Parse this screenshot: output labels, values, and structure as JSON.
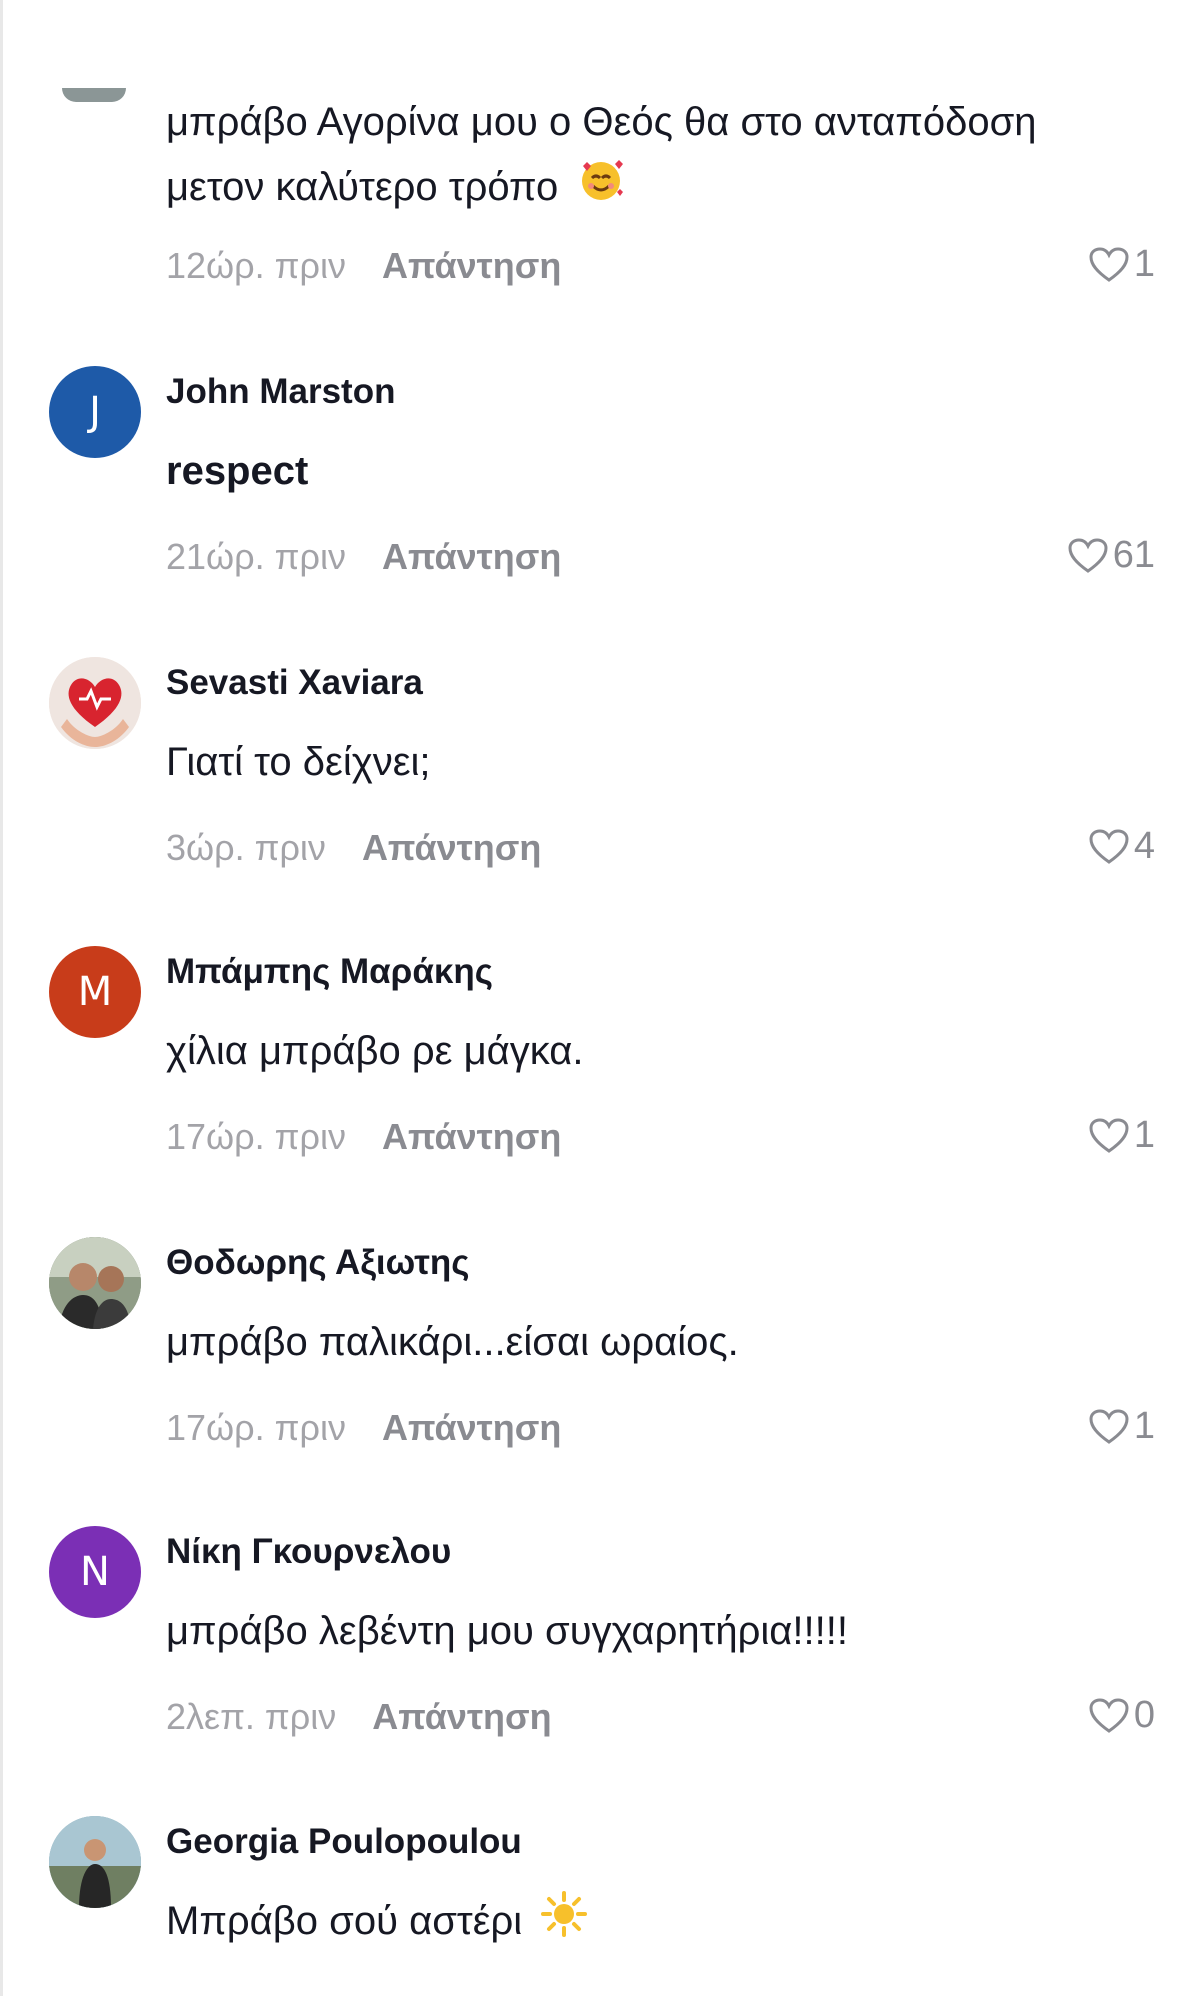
{
  "comments": [
    {
      "author": "",
      "text_line1": "μπράβο Αγορίνα μου ο Θεός θα στο ανταπόδοση",
      "text_line2": "μετον καλύτερο τρόπο",
      "emoji": "smiling-face-with-hearts",
      "time": "12ώρ. πριν",
      "reply": "Απάντηση",
      "likes": "1"
    },
    {
      "author": "John Marston",
      "avatar_letter": "J",
      "avatar_color": "#1e5aa8",
      "text": "respect",
      "time": "21ώρ. πριν",
      "reply": "Απάντηση",
      "likes": "61"
    },
    {
      "author": "Sevasti Xaviara",
      "avatar_icon": "heart-in-hands-photo",
      "text": "Γιατί το δείχνει;",
      "time": "3ώρ. πριν",
      "reply": "Απάντηση",
      "likes": "4"
    },
    {
      "author": "Μπάμπης Μαράκης",
      "avatar_letter": "M",
      "avatar_color": "#c83c1a",
      "text": "χίλια μπράβο ρε μάγκα.",
      "time": "17ώρ. πριν",
      "reply": "Απάντηση",
      "likes": "1"
    },
    {
      "author": "Θοδωρης Αξιωτης",
      "avatar_icon": "profile-photo",
      "text": "μπράβο παλικάρι...είσαι ωραίος.",
      "time": "17ώρ. πριν",
      "reply": "Απάντηση",
      "likes": "1"
    },
    {
      "author": "Νίκη Γκουρνελου",
      "avatar_letter": "N",
      "avatar_color": "#7b2fb5",
      "text": "μπράβο λεβέντη μου συγχαρητήρια!!!!!",
      "time": "2λεπ. πριν",
      "reply": "Απάντηση",
      "likes": "0"
    },
    {
      "author": "Georgia Poulopoulou",
      "avatar_icon": "profile-photo",
      "text": "Μπράβο σού αστέρι",
      "emoji": "sun-emoji",
      "time": "",
      "reply": "",
      "likes": ""
    }
  ]
}
